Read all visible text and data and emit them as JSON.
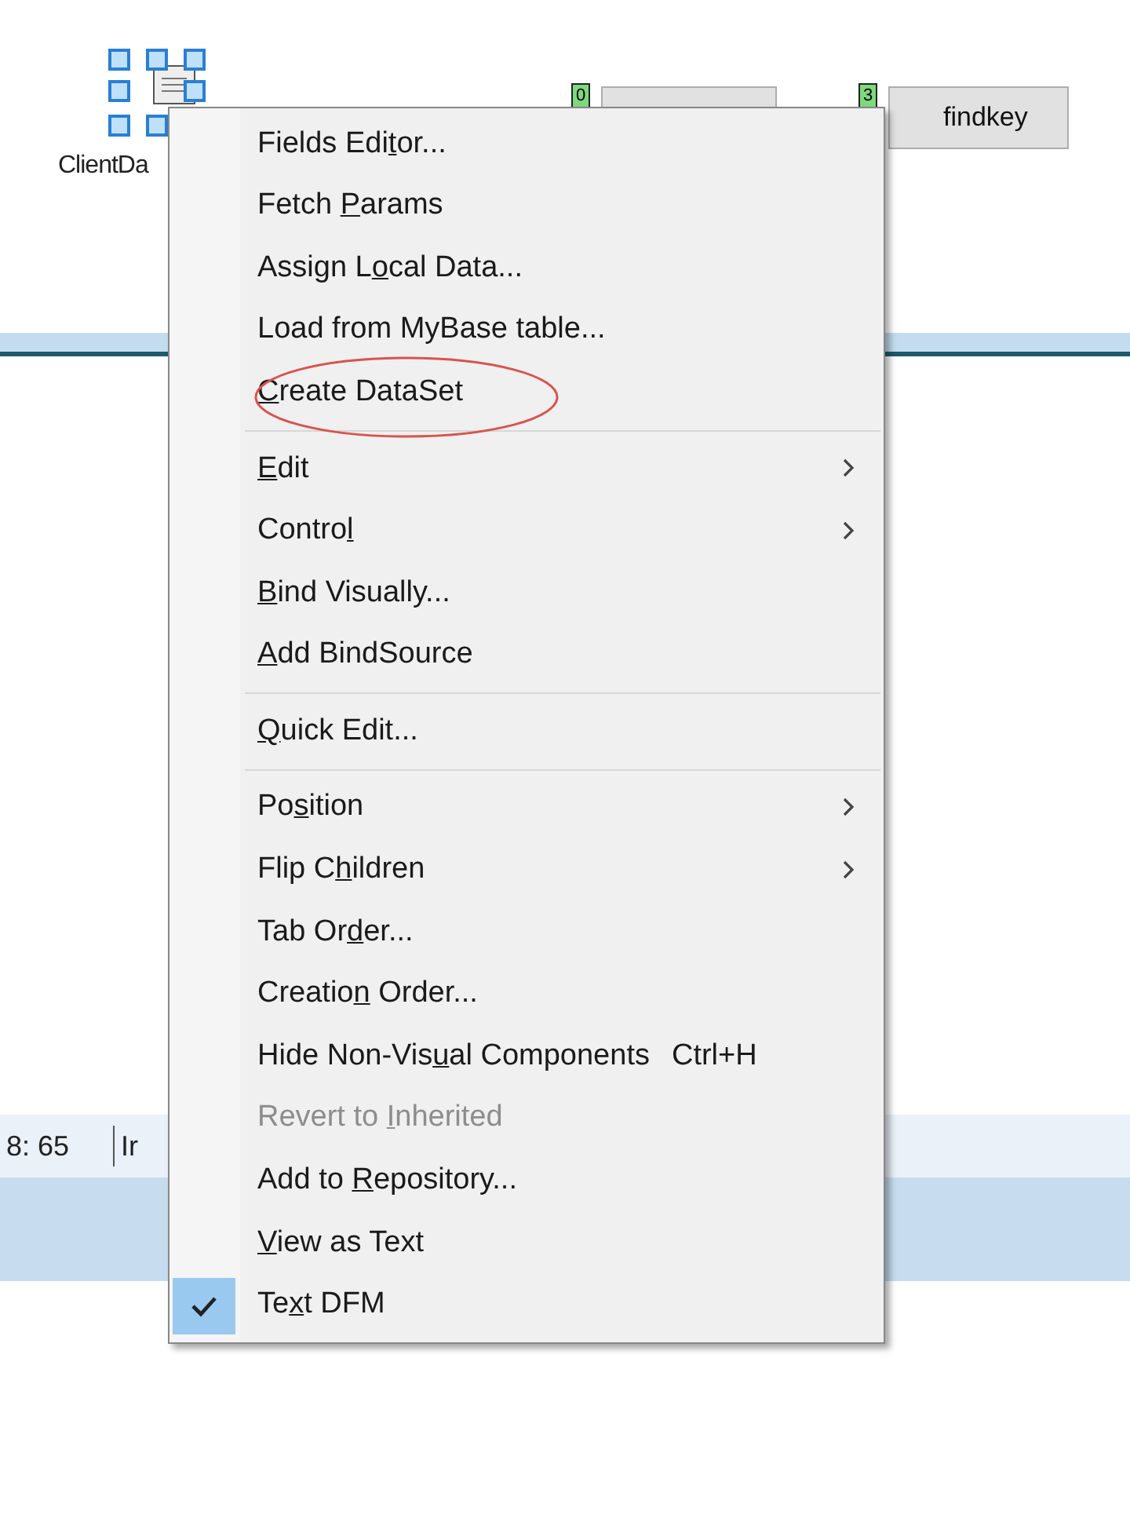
{
  "designer": {
    "component": {
      "caption": "ClientDa",
      "selected": true
    },
    "buttons": [
      {
        "tag": "0"
      },
      {
        "tag": "3",
        "caption": "findkey"
      }
    ],
    "status_bar": {
      "position": "8: 65",
      "mode": "Ir"
    }
  },
  "context_menu": {
    "items": [
      {
        "kind": "item",
        "before": "Fields Edi",
        "key": "t",
        "after": "or...",
        "submenu": false,
        "disabled": false,
        "checked": false,
        "circled": false
      },
      {
        "kind": "item",
        "before": "Fetch ",
        "key": "P",
        "after": "arams",
        "submenu": false,
        "disabled": false,
        "checked": false,
        "circled": false
      },
      {
        "kind": "item",
        "before": "Assign L",
        "key": "o",
        "after": "cal Data...",
        "submenu": false,
        "disabled": false,
        "checked": false,
        "circled": false
      },
      {
        "kind": "item",
        "before": "Load from MyBase table...",
        "submenu": false,
        "disabled": false,
        "checked": false,
        "circled": false
      },
      {
        "kind": "item",
        "key": "C",
        "after": "reate DataSet",
        "submenu": false,
        "disabled": false,
        "checked": false,
        "circled": true
      },
      {
        "kind": "separator"
      },
      {
        "kind": "item",
        "key": "E",
        "after": "dit",
        "submenu": true,
        "disabled": false,
        "checked": false,
        "circled": false
      },
      {
        "kind": "item",
        "before": "Contro",
        "key": "l",
        "submenu": true,
        "disabled": false,
        "checked": false,
        "circled": false
      },
      {
        "kind": "item",
        "key": "B",
        "after": "ind Visually...",
        "submenu": false,
        "disabled": false,
        "checked": false,
        "circled": false
      },
      {
        "kind": "item",
        "key": "A",
        "after": "dd BindSource",
        "submenu": false,
        "disabled": false,
        "checked": false,
        "circled": false
      },
      {
        "kind": "separator"
      },
      {
        "kind": "item",
        "key": "Q",
        "after": "uick Edit...",
        "submenu": false,
        "disabled": false,
        "checked": false,
        "circled": false
      },
      {
        "kind": "separator"
      },
      {
        "kind": "item",
        "before": "Po",
        "key": "s",
        "after": "ition",
        "submenu": true,
        "disabled": false,
        "checked": false,
        "circled": false
      },
      {
        "kind": "item",
        "before": "Flip C",
        "key": "h",
        "after": "ildren",
        "submenu": true,
        "disabled": false,
        "checked": false,
        "circled": false
      },
      {
        "kind": "item",
        "before": "Tab Or",
        "key": "d",
        "after": "er...",
        "submenu": false,
        "disabled": false,
        "checked": false,
        "circled": false
      },
      {
        "kind": "item",
        "before": "Creatio",
        "key": "n",
        "after": " Order...",
        "submenu": false,
        "disabled": false,
        "checked": false,
        "circled": false
      },
      {
        "kind": "item",
        "before": "Hide Non-Vis",
        "key": "u",
        "after": "al Components",
        "shortcut": "Ctrl+H",
        "submenu": false,
        "disabled": false,
        "checked": false,
        "circled": false
      },
      {
        "kind": "item",
        "before": "Revert to ",
        "key": "I",
        "after": "nherited",
        "submenu": false,
        "disabled": true,
        "checked": false,
        "circled": false
      },
      {
        "kind": "item",
        "before": "Add to ",
        "key": "R",
        "after": "epository...",
        "submenu": false,
        "disabled": false,
        "checked": false,
        "circled": false
      },
      {
        "kind": "item",
        "key": "V",
        "after": "iew as Text",
        "submenu": false,
        "disabled": false,
        "checked": false,
        "circled": false
      },
      {
        "kind": "item",
        "before": "Te",
        "key": "x",
        "after": "t DFM",
        "submenu": false,
        "disabled": false,
        "checked": true,
        "circled": false
      }
    ]
  }
}
